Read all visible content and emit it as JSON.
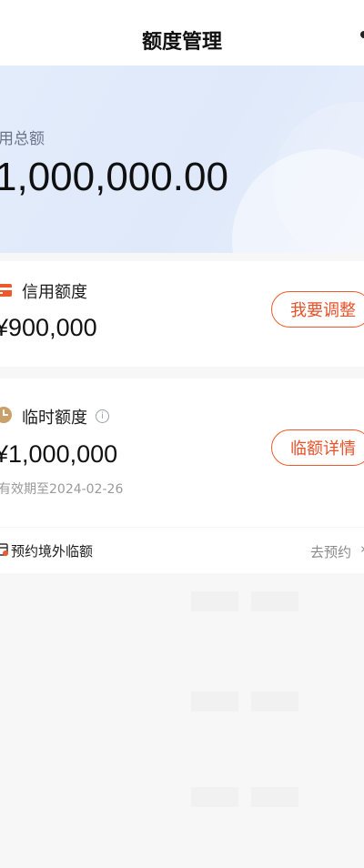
{
  "nav": {
    "title": "额度管理"
  },
  "hero": {
    "label": "用总额",
    "amount": "1,000,000.00"
  },
  "credit": {
    "title": "信用额度",
    "amount": "¥900,000",
    "button": "我要调整",
    "icon": "card-icon"
  },
  "temp": {
    "title": "临时额度",
    "amount": "¥1,000,000",
    "validity": "有效期至2024-02-26",
    "button": "临额详情",
    "info": "i",
    "icon": "clock-icon"
  },
  "overseas": {
    "label": "预约境外临额",
    "action": "去预约",
    "chevron": "›",
    "icon": "calendar-icon"
  },
  "colors": {
    "accent": "#ec5a2c",
    "heroBg": "#e3ecfb"
  }
}
